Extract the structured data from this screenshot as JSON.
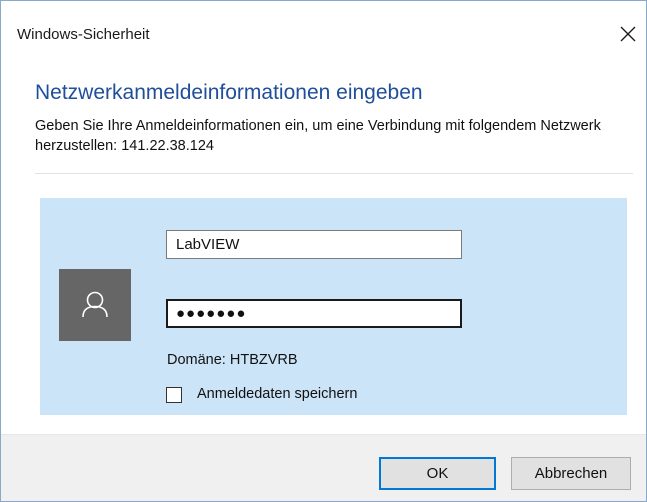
{
  "window": {
    "title": "Windows-Sicherheit",
    "close_icon": "close-icon"
  },
  "dialog": {
    "heading": "Netzwerkanmeldeinformationen eingeben",
    "description": "Geben Sie Ihre Anmeldeinformationen ein, um eine Verbindung mit folgendem Netzwerk herzustellen: 141.22.38.124"
  },
  "credentials": {
    "avatar_icon": "user-icon",
    "username_value": "LabVIEW",
    "password_value": "●●●●●●●",
    "domain_text": "Domäne: HTBZVRB",
    "remember_label": "Anmeldedaten speichern",
    "remember_checked": false
  },
  "buttons": {
    "ok_label": "OK",
    "cancel_label": "Abbrechen"
  },
  "colors": {
    "accent": "#0078d7",
    "heading": "#1f4e9a",
    "panel_bg": "#cce4f7",
    "avatar_bg": "#666666"
  }
}
